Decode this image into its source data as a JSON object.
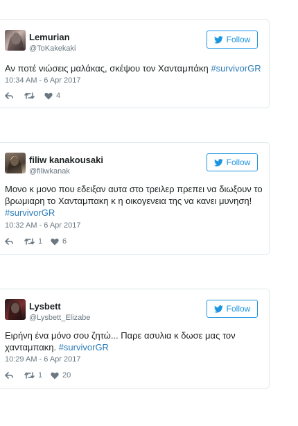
{
  "follow_label": "Follow",
  "colors": {
    "accent": "#1b95e0",
    "hashtag": "#2b7bb9",
    "muted": "#697882",
    "border": "#e1e8ed"
  },
  "tweets": [
    {
      "name": "Lemurian",
      "handle": "@ToKakekaki",
      "text": "Αν ποτέ νιώσεις μαλάκας, σκέψου τον Χανταμπάκη ",
      "hashtag": "#survivorGR",
      "date": "10:34 AM - 6 Apr 2017",
      "retweets": "",
      "likes": "4"
    },
    {
      "name": "filiw kanakousaki",
      "handle": "@filiwkanak",
      "text": "Μονο κ μονο που εδειξαν αυτα στο τρειλερ πρεπει να διωξουν το βρωμιαρη το Χανταμπακη κ η οικογενεια της να κανει μυνηση! ",
      "hashtag": "#survivorGR",
      "date": "10:32 AM - 6 Apr 2017",
      "retweets": "1",
      "likes": "6"
    },
    {
      "name": "Lysbett",
      "handle": "@Lysbett_Elizabe",
      "text": "Ειρήνη ένα μόνο σου ζητώ... Παρε ασυλια κ δωσε μας τον χανταμπακη. ",
      "hashtag": "#survivorGR",
      "date": "10:29 AM - 6 Apr 2017",
      "retweets": "1",
      "likes": "20"
    }
  ]
}
